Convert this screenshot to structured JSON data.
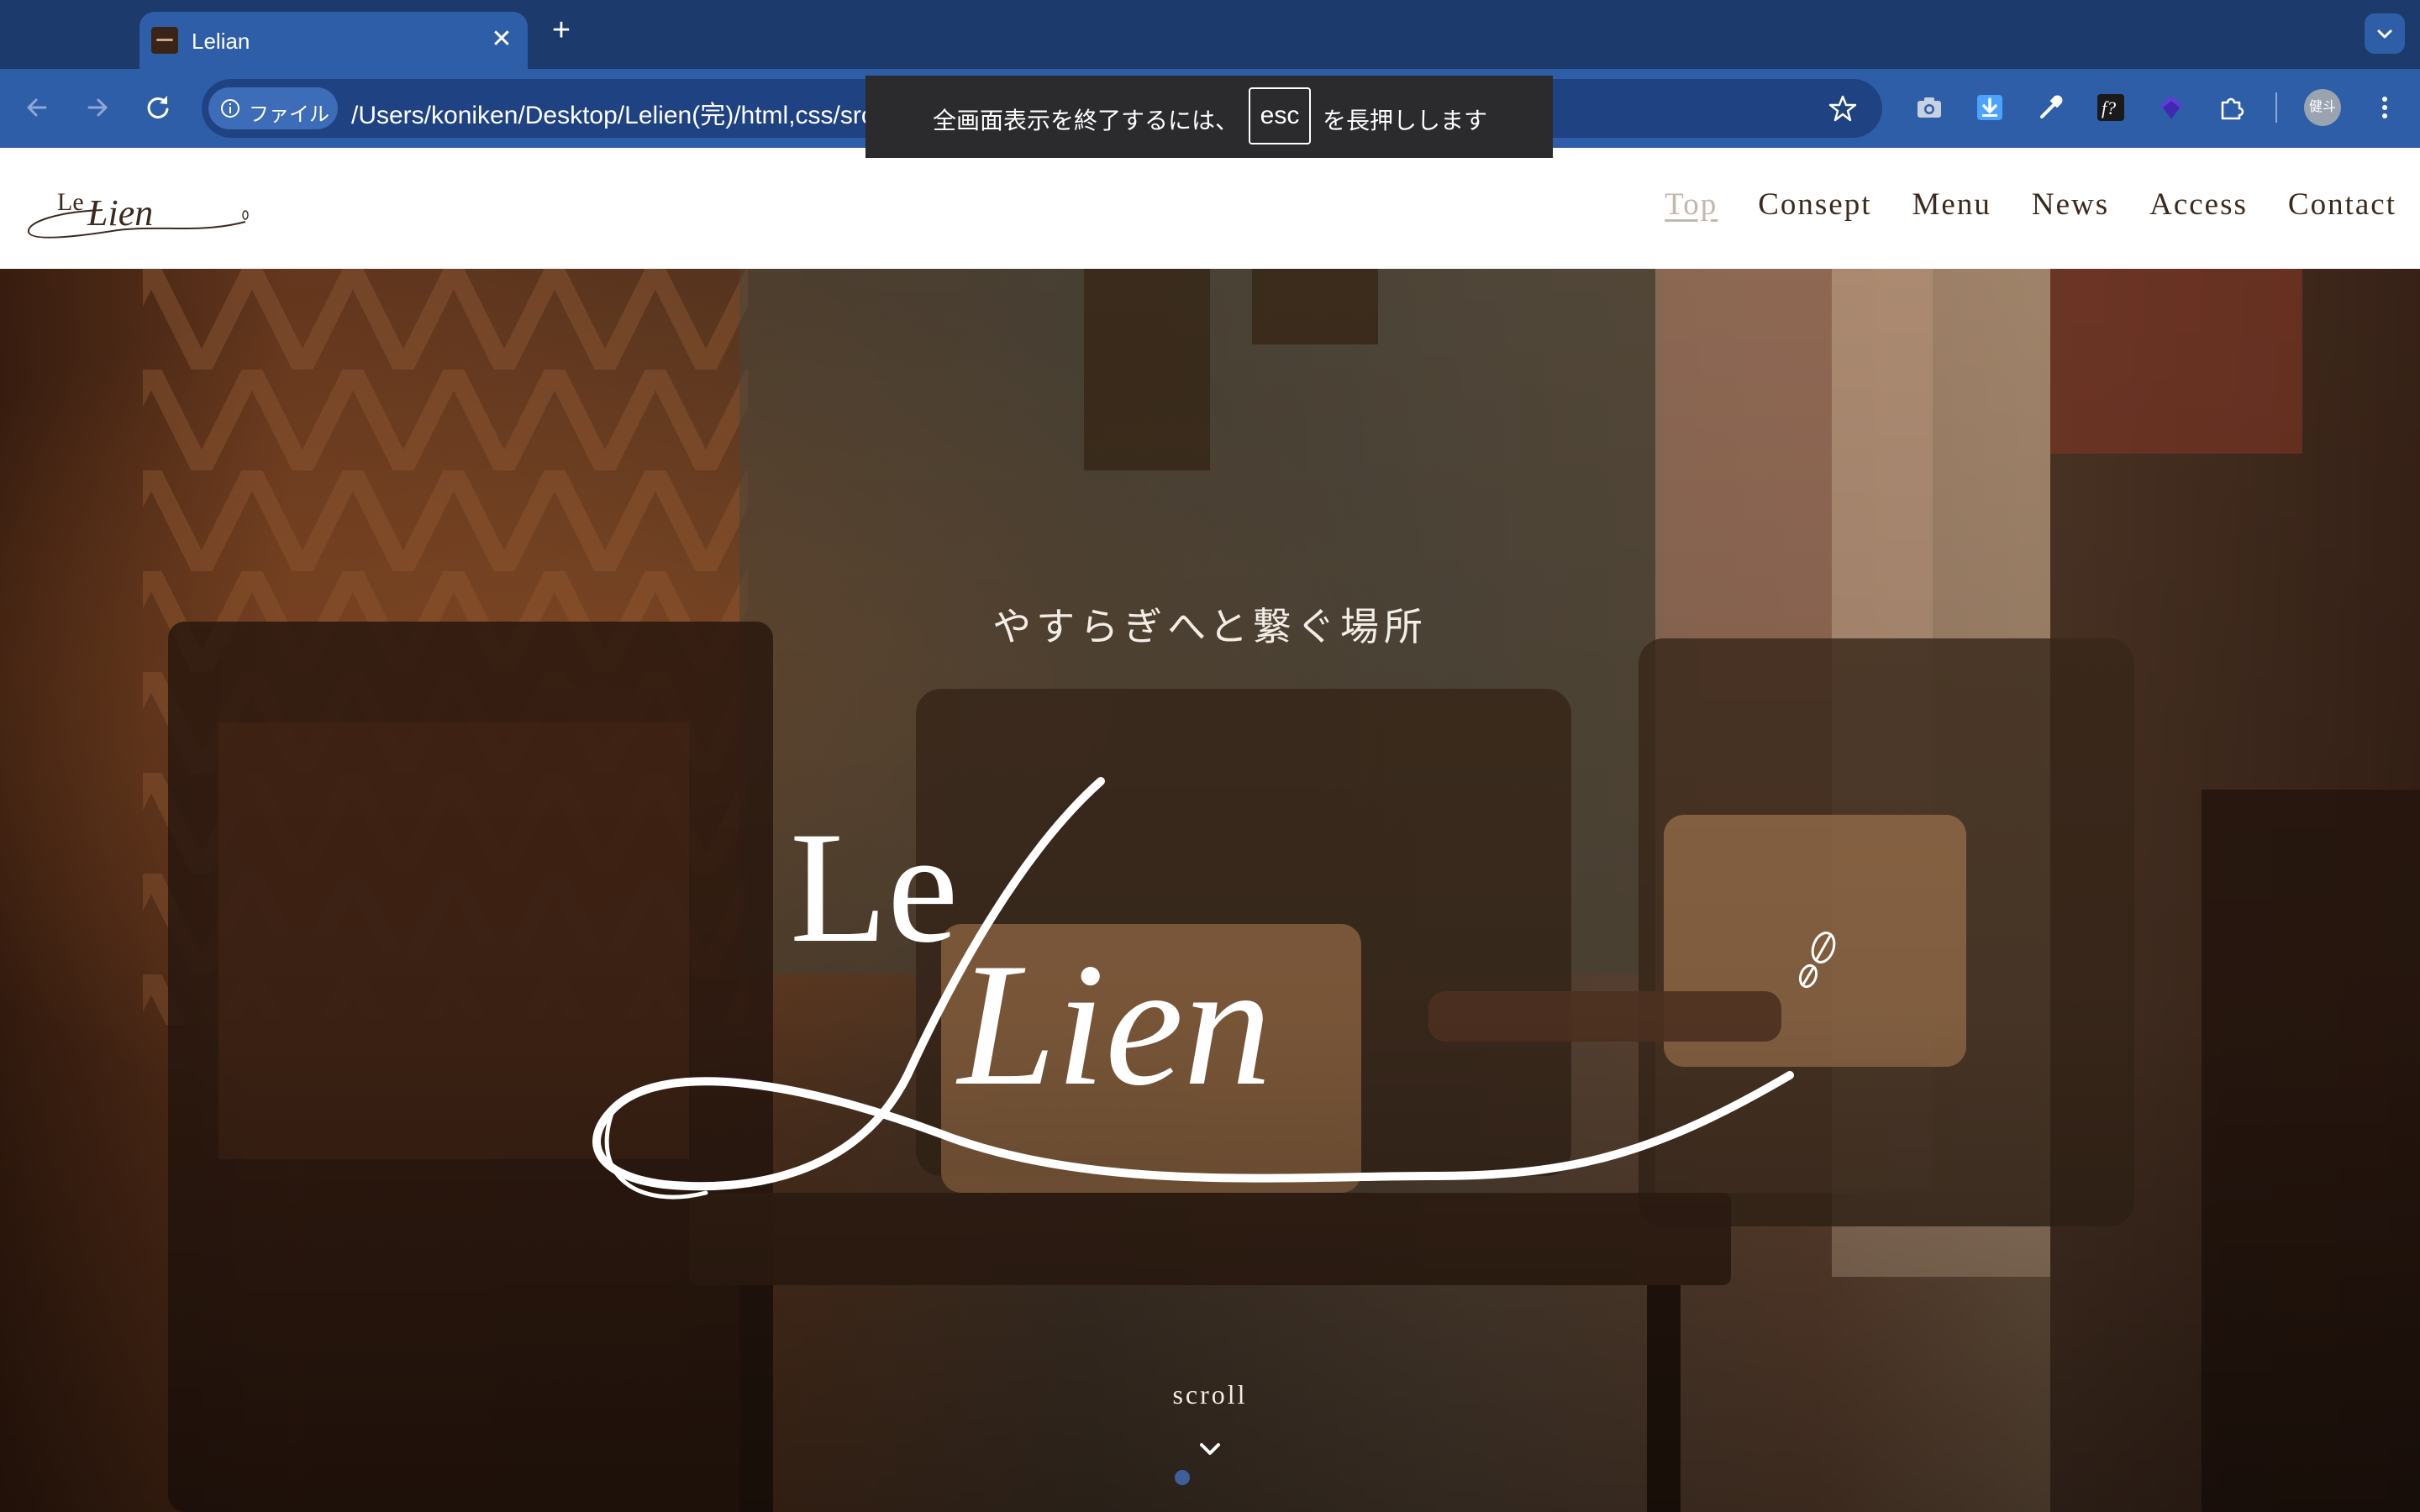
{
  "browser": {
    "tab": {
      "title": "Lelian",
      "close": "✕"
    },
    "new_tab": "+",
    "address": {
      "chip_label": "ファイル",
      "url": "/Users/koniken/Desktop/Lelien(完)/html,css/src/index.html"
    },
    "profile_label": "健斗",
    "fullscreen_notice": {
      "before": "全画面表示を終了するには、",
      "key": "esc",
      "after": "を長押しします"
    },
    "extension_icons": [
      "camera-icon",
      "download-icon",
      "eyedropper-icon",
      "font-finder-icon",
      "layers-icon",
      "puzzle-icon"
    ],
    "colors": {
      "tabbar": "#1c3a6b",
      "toolbar": "#2f5ea8",
      "omnibox": "#1f4282"
    }
  },
  "site": {
    "logo": {
      "prefix": "Le",
      "word": "Lien"
    },
    "nav": [
      {
        "label": "Top",
        "active": true
      },
      {
        "label": "Consept",
        "active": false
      },
      {
        "label": "Menu",
        "active": false
      },
      {
        "label": "News",
        "active": false
      },
      {
        "label": "Access",
        "active": false
      },
      {
        "label": "Contact",
        "active": false
      }
    ],
    "hero": {
      "tagline": "やすらぎへと繋ぐ場所",
      "logo_prefix": "Le",
      "logo_word": "Lien",
      "scroll_label": "scroll"
    },
    "colors": {
      "brand_text": "#3b2a1e",
      "nav_active": "#c3b7ad",
      "hero_text": "#ffffff"
    }
  }
}
